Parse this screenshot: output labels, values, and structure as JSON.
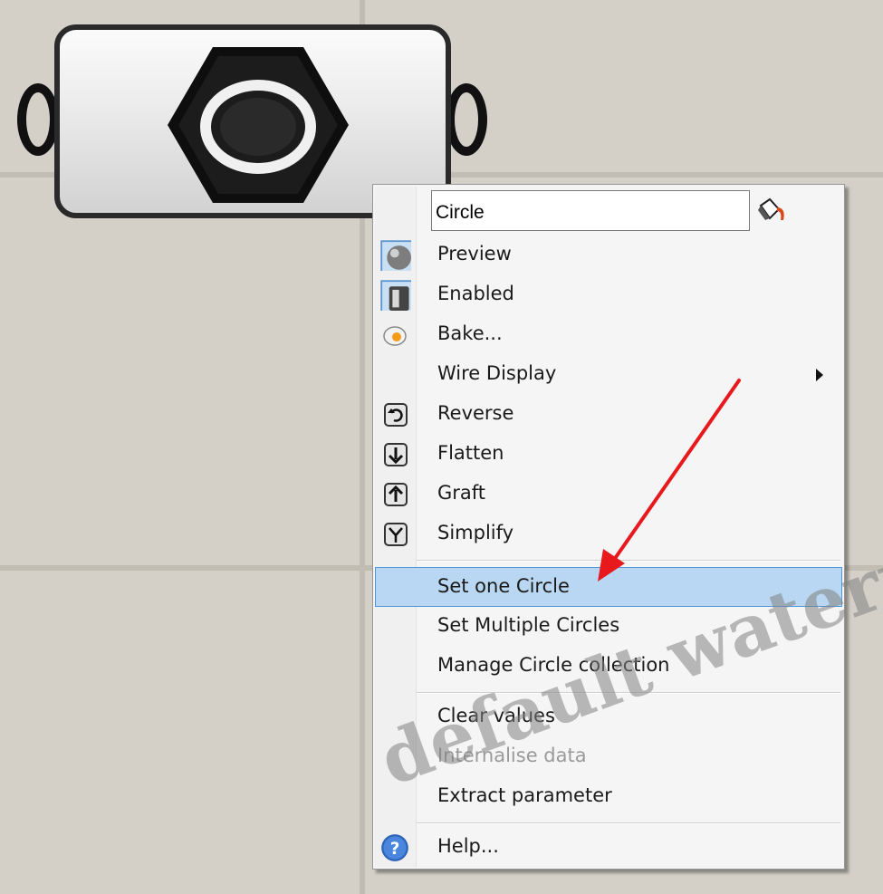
{
  "component": {
    "icon": "hexagon-circle-param-icon"
  },
  "context_menu": {
    "name_field": {
      "value": "Circle"
    },
    "paint_icon": "paint-bucket-icon",
    "items": [
      {
        "label": "Preview",
        "icon": "preview-sphere-icon"
      },
      {
        "label": "Enabled",
        "icon": "enabled-switch-icon"
      },
      {
        "label": "Bake...",
        "icon": "bake-egg-icon"
      },
      {
        "label": "Wire Display",
        "icon": "submenu-arrow-icon"
      },
      {
        "label": "Reverse",
        "icon": "reverse-icon"
      },
      {
        "label": "Flatten",
        "icon": "flatten-icon"
      },
      {
        "label": "Graft",
        "icon": "graft-icon"
      },
      {
        "label": "Simplify",
        "icon": "simplify-icon"
      },
      {
        "label": "Set one Circle",
        "state": "highlighted"
      },
      {
        "label": "Set Multiple Circles"
      },
      {
        "label": "Manage Circle collection"
      },
      {
        "label": "Clear values"
      },
      {
        "label": "Internalise data",
        "state": "disabled"
      },
      {
        "label": "Extract parameter"
      },
      {
        "label": "Help...",
        "icon": "help-icon"
      }
    ]
  },
  "annotation": {
    "arrow_color": "#e8191c",
    "icon": "red-arrow-icon"
  },
  "watermark": "default watermark",
  "colors": {
    "canvas": "#d4d0c8",
    "menu_highlight": "#b9d7f2",
    "menu_highlight_border": "#4f97d9"
  }
}
